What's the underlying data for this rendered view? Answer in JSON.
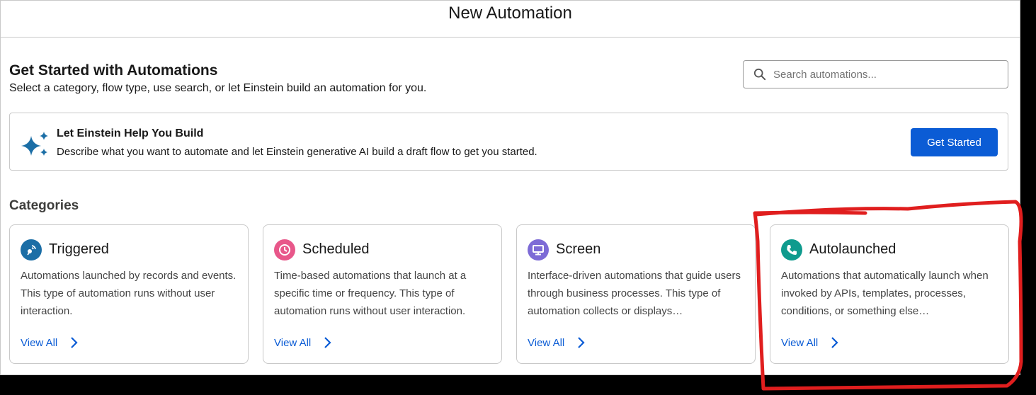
{
  "header": {
    "title": "New Automation"
  },
  "intro": {
    "title": "Get Started with Automations",
    "subtitle": "Select a category, flow type, use search, or let Einstein build an automation for you."
  },
  "search": {
    "placeholder": "Search automations..."
  },
  "einstein": {
    "title": "Let Einstein Help You Build",
    "description": "Describe what you want to automate and let Einstein generative AI build a draft flow to get you started.",
    "button": "Get Started"
  },
  "categories": {
    "title": "Categories",
    "items": [
      {
        "name": "Triggered",
        "icon": "triggered-icon",
        "color": "#1b6ea6",
        "description": "Automations launched by records and events. This type of automation runs without user interaction.",
        "link": "View All"
      },
      {
        "name": "Scheduled",
        "icon": "clock-icon",
        "color": "#e8578a",
        "description": "Time-based automations that launch at a specific time or frequency. This type of automation runs without user interaction.",
        "link": "View All"
      },
      {
        "name": "Screen",
        "icon": "monitor-icon",
        "color": "#7d6bd6",
        "description": "Interface-driven automations that guide users through business processes. This type of automation collects or displays…",
        "link": "View All"
      },
      {
        "name": "Autolaunched",
        "icon": "phone-icon",
        "color": "#0f9b8e",
        "description": "Automations that automatically launch when invoked by APIs, templates, processes, conditions, or something else…",
        "link": "View All"
      }
    ]
  },
  "colors": {
    "brand": "#0b5cd5",
    "annotation": "#e01e1e"
  }
}
